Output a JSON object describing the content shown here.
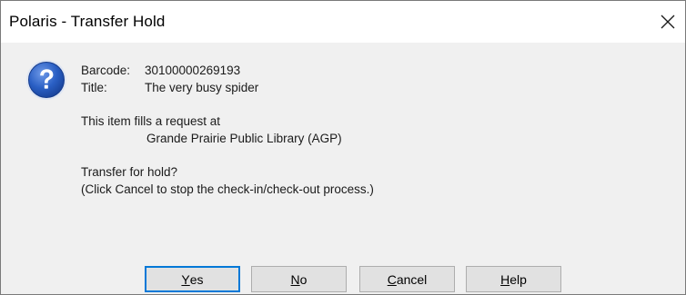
{
  "window": {
    "title": "Polaris - Transfer Hold",
    "close_icon": "close-x-icon"
  },
  "dialog": {
    "icon": "question-icon",
    "icon_colors": {
      "fill": "#1c4fb0",
      "highlight": "#6f9ae8",
      "ring": "#dfe6f3"
    },
    "barcode_label": "Barcode:",
    "barcode_value": "30100000269193",
    "title_label": "Title:",
    "title_value": "The very busy spider",
    "request_line": "This item fills a request at",
    "library": "Grande Prairie Public Library (AGP)",
    "question": "Transfer for hold?",
    "note": "(Click Cancel to stop the check-in/check-out process.)"
  },
  "buttons": {
    "yes": {
      "accel": "Y",
      "rest": "es"
    },
    "no": {
      "accel": "N",
      "rest": "o"
    },
    "cancel": {
      "accel": "C",
      "rest": "ancel"
    },
    "help": {
      "accel": "H",
      "rest": "elp"
    },
    "default_border_color": "#0078d7"
  }
}
